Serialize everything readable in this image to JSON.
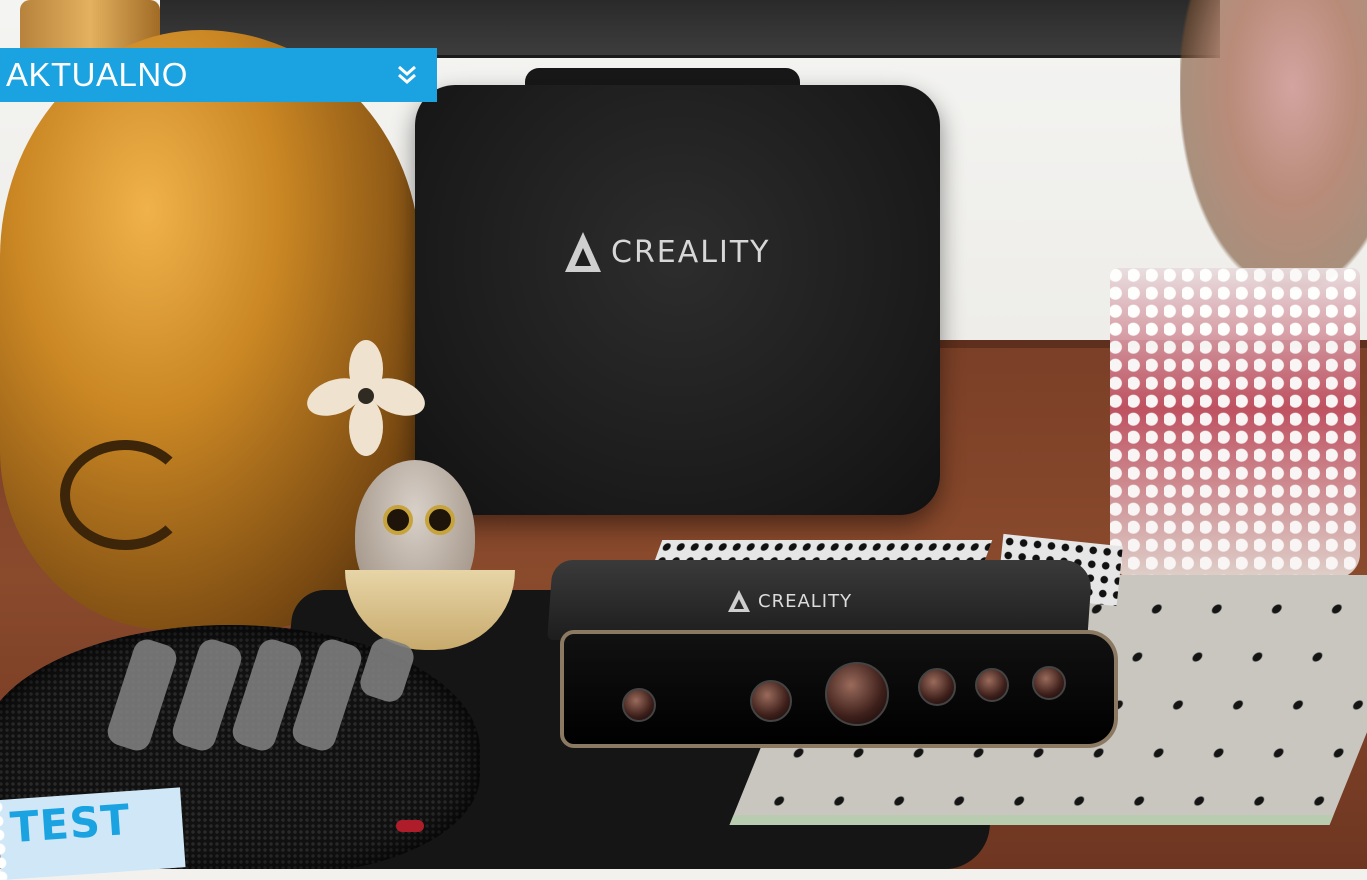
{
  "banner": {
    "title": "AKTUALNO",
    "toggle_icon": "double-chevron-down-icon",
    "color": "#1aa3e0"
  },
  "stamp": {
    "label": "TEST",
    "background": "#cfe7f7",
    "text_color": "#1aa3e0"
  },
  "photo": {
    "case_brand": "CREALITY",
    "scanner_brand": "CREALITY"
  }
}
